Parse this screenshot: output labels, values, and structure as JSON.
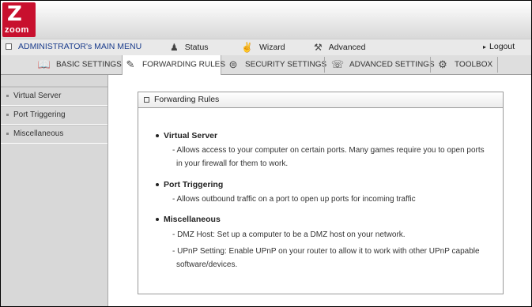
{
  "logo": {
    "letter": "Z",
    "word": "zoom"
  },
  "menu": {
    "admin_label": "ADMINISTRATOR's MAIN MENU",
    "status_label": "Status",
    "wizard_label": "Wizard",
    "advanced_label": "Advanced",
    "logout_label": "Logout"
  },
  "tabs": [
    {
      "label": "BASIC SETTINGS",
      "icon": "book-icon"
    },
    {
      "label": "FORWARDING RULES",
      "icon": "forwarding-icon",
      "active": true
    },
    {
      "label": "SECURITY SETTINGS",
      "icon": "security-icon"
    },
    {
      "label": "ADVANCED SETTINGS",
      "icon": "advanced-icon"
    },
    {
      "label": "TOOLBOX",
      "icon": "toolbox-icon"
    }
  ],
  "sidebar": {
    "items": [
      {
        "label": "Virtual Server"
      },
      {
        "label": "Port Triggering"
      },
      {
        "label": "Miscellaneous"
      }
    ]
  },
  "panel": {
    "title": "Forwarding Rules",
    "sections": [
      {
        "heading": "Virtual Server",
        "lines": [
          "- Allows access to your computer on certain ports. Many games require you to open ports",
          "in your firewall for them to work."
        ]
      },
      {
        "heading": "Port Triggering",
        "lines": [
          "- Allows outbound traffic on a port to open up ports for incoming traffic"
        ]
      },
      {
        "heading": "Miscellaneous",
        "lines": [
          "- DMZ Host: Set up a computer to be a DMZ host on your network.",
          "- UPnP Setting: Enable UPnP on your router to allow it to work with other UPnP capable",
          "software/devices."
        ]
      }
    ]
  },
  "colors": {
    "brand": "#c8102e",
    "menu_text": "#1a3c8c"
  }
}
